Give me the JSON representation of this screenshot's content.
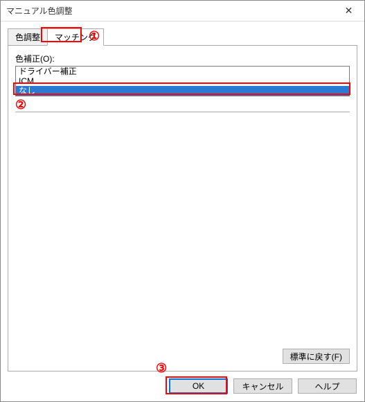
{
  "window": {
    "title": "マニュアル色調整"
  },
  "tabs": {
    "color_adjust": "色調整",
    "matching": "マッチング"
  },
  "main": {
    "color_correction_label": "色補正(O):",
    "listbox": {
      "items": [
        "ドライバー補正",
        "ICM",
        "なし"
      ],
      "selected": "なし"
    },
    "defaults_button": "標準に戻す(F)"
  },
  "actions": {
    "ok": "OK",
    "cancel": "キャンセル",
    "help": "ヘルプ"
  },
  "annotations": {
    "one": "①",
    "two": "②",
    "three": "③"
  }
}
